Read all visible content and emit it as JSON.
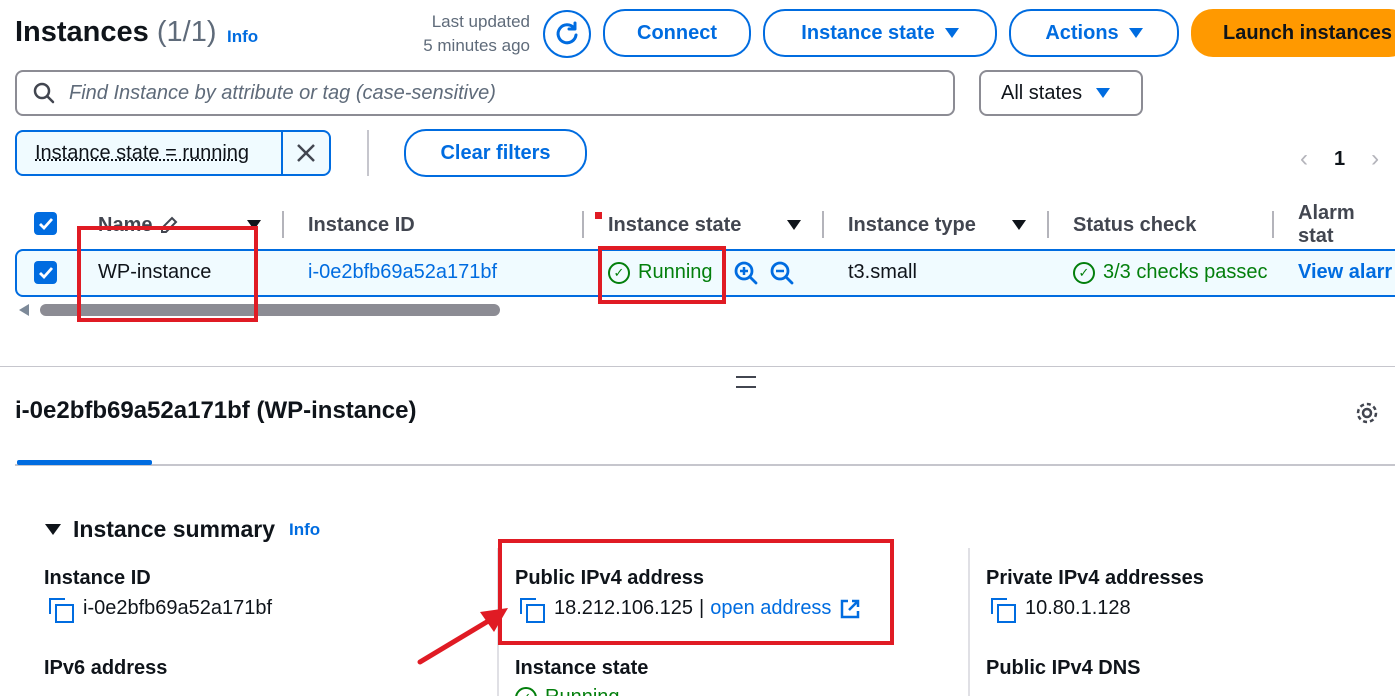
{
  "header": {
    "title": "Instances",
    "count": "(1/1)",
    "info": "Info",
    "last_updated_line1": "Last updated",
    "last_updated_line2": "5 minutes ago",
    "connect": "Connect",
    "instance_state": "Instance state",
    "actions": "Actions",
    "launch": "Launch instances"
  },
  "search": {
    "placeholder": "Find Instance by attribute or tag (case-sensitive)",
    "states_filter": "All states"
  },
  "filter": {
    "token": "Instance state = running",
    "clear": "Clear filters",
    "page": "1"
  },
  "table": {
    "columns": [
      "Name",
      "Instance ID",
      "Instance state",
      "Instance type",
      "Status check",
      "Alarm stat"
    ],
    "rows": [
      {
        "name": "WP-instance",
        "instance_id": "i-0e2bfb69a52a171bf",
        "state": "Running",
        "type": "t3.small",
        "status_check": "3/3 checks passec",
        "alarm": "View alarr"
      }
    ]
  },
  "details": {
    "title": "i-0e2bfb69a52a171bf (WP-instance)",
    "summary_title": "Instance summary",
    "summary_info": "Info",
    "instance_id_label": "Instance ID",
    "instance_id_value": "i-0e2bfb69a52a171bf",
    "public_ipv4_label": "Public IPv4 address",
    "public_ipv4_value": "18.212.106.125",
    "open_address": "open address",
    "private_ipv4_label": "Private IPv4 addresses",
    "private_ipv4_value": "10.80.1.128",
    "ipv6_label": "IPv6 address",
    "instance_state_label": "Instance state",
    "instance_state_value": "Running",
    "public_dns_label": "Public IPv4 DNS"
  },
  "colors": {
    "primary": "#006ce0",
    "launch_orange": "#ff9900",
    "running_green": "#037f0c",
    "annotation_red": "#e01b24"
  }
}
